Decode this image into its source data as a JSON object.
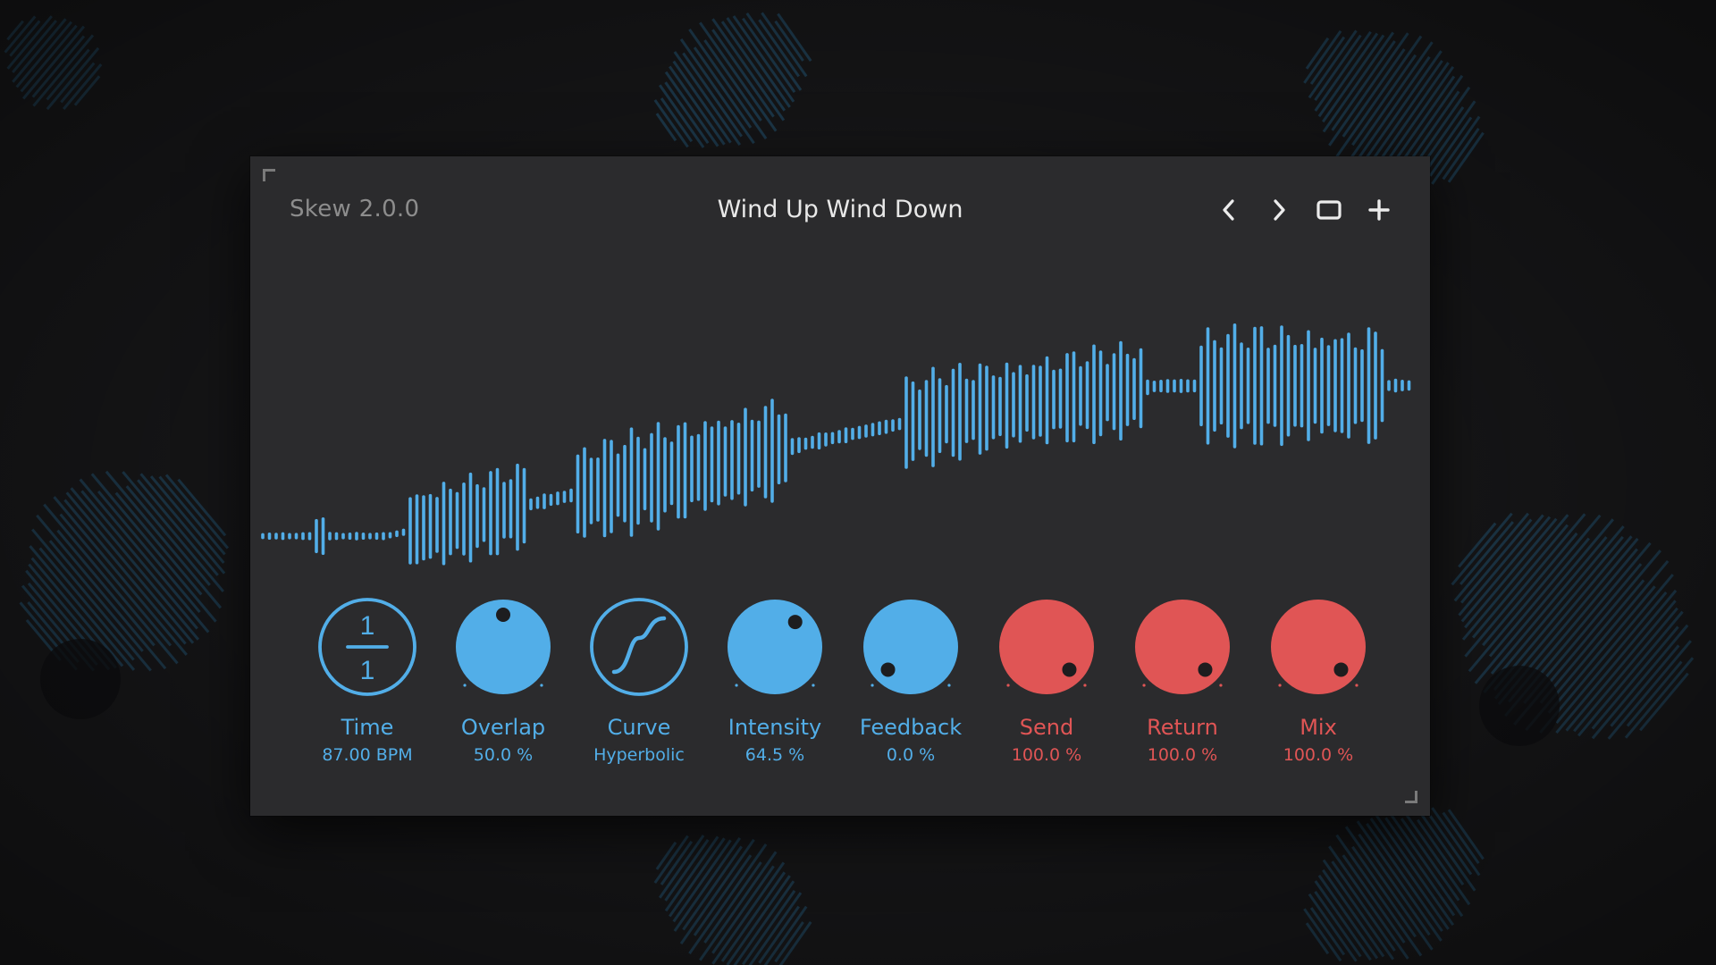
{
  "app_version": "Skew 2.0.0",
  "preset_name": "Wind Up Wind Down",
  "nav_icons": [
    "chevron-left-icon",
    "chevron-right-icon",
    "window-icon",
    "plus-icon"
  ],
  "colors": {
    "blue": "#52aee8",
    "red": "#e05555",
    "panel": "#2b2b2d",
    "text": "#e8e8e8",
    "muted": "#8d8d8d"
  },
  "time_fraction": {
    "numerator": "1",
    "denominator": "1"
  },
  "knobs": [
    {
      "label": "Time",
      "value": "87.00 BPM",
      "color": "blue",
      "style": "fraction"
    },
    {
      "label": "Overlap",
      "value": "50.0 %",
      "color": "blue",
      "level": 0.5
    },
    {
      "label": "Curve",
      "value": "Hyperbolic",
      "color": "blue",
      "style": "curve"
    },
    {
      "label": "Intensity",
      "value": "64.5 %",
      "color": "blue",
      "level": 0.645
    },
    {
      "label": "Feedback",
      "value": "0.0 %",
      "color": "blue",
      "level": 0.0
    },
    {
      "label": "Send",
      "value": "100.0 %",
      "color": "red",
      "level": 1.0
    },
    {
      "label": "Return",
      "value": "100.0 %",
      "color": "red",
      "level": 1.0
    },
    {
      "label": "Mix",
      "value": "100.0 %",
      "color": "red",
      "level": 1.0
    }
  ]
}
